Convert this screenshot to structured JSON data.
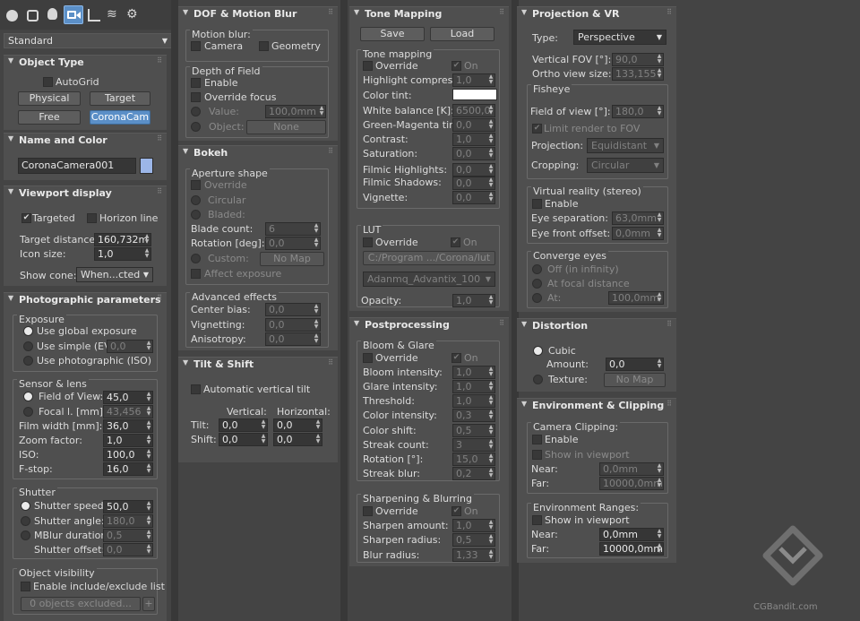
{
  "toolbar": {
    "icons": [
      "create-icon",
      "shapes-icon",
      "lights-icon",
      "cameras-icon",
      "helpers-icon",
      "spacewarps-icon",
      "systems-icon"
    ]
  },
  "category_dropdown": "Standard",
  "object_type": {
    "title": "Object Type",
    "autogrid": "AutoGrid",
    "buttons": [
      "Physical",
      "Target",
      "Free",
      "CoronaCam"
    ]
  },
  "name_color": {
    "title": "Name and Color",
    "name": "CoronaCamera001",
    "color": "#9cb6e8"
  },
  "viewport": {
    "title": "Viewport display",
    "targeted": "Targeted",
    "horizon": "Horizon line",
    "target_distance_label": "Target distance:",
    "target_distance": "160,732m",
    "icon_size_label": "Icon size:",
    "icon_size": "1,0",
    "show_cone_label": "Show cone:",
    "show_cone": "When...cted"
  },
  "photo": {
    "title": "Photographic parameters",
    "exposure": {
      "title": "Exposure",
      "global": "Use global exposure",
      "simple": "Use simple (EV)",
      "simple_val": "0,0",
      "iso": "Use photographic (ISO)"
    },
    "sensor": {
      "title": "Sensor & lens",
      "fov_label": "Field of View:",
      "fov": "45,0",
      "focal_label": "Focal l. [mm]:",
      "focal": "43,456",
      "film_label": "Film width [mm]:",
      "film": "36,0",
      "zoom_label": "Zoom factor:",
      "zoom": "1,0",
      "iso_label": "ISO:",
      "iso": "100,0",
      "fstop_label": "F-stop:",
      "fstop": "16,0"
    },
    "shutter": {
      "title": "Shutter",
      "speed_label": "Shutter speed:",
      "speed": "50,0",
      "angle_label": "Shutter angle:",
      "angle": "180,0",
      "mblur_label": "MBlur duration:",
      "mblur": "0,5",
      "offset_label": "Shutter offset:",
      "offset": "0,0"
    },
    "visibility": {
      "title": "Object visibility",
      "enable": "Enable include/exclude list",
      "excluded": "0 objects excluded...",
      "plus": "+"
    }
  },
  "dof": {
    "title": "DOF & Motion Blur",
    "motion_blur": "Motion blur:",
    "camera": "Camera",
    "geometry": "Geometry",
    "depth": "Depth of Field",
    "enable": "Enable",
    "override": "Override focus",
    "value_label": "Value:",
    "value": "100,0mm",
    "object_label": "Object:",
    "object": "None"
  },
  "bokeh": {
    "title": "Bokeh",
    "aperture": "Aperture shape",
    "override": "Override",
    "circular": "Circular",
    "bladed": "Bladed:",
    "blade_count_label": "Blade count:",
    "blade_count": "6",
    "rotation_label": "Rotation [deg]:",
    "rotation": "0,0",
    "custom_label": "Custom:",
    "custom": "No Map",
    "affect": "Affect exposure",
    "advanced": "Advanced effects",
    "center_bias_label": "Center bias:",
    "center_bias": "0,0",
    "vignetting_label": "Vignetting:",
    "vignetting": "0,0",
    "anisotropy_label": "Anisotropy:",
    "anisotropy": "0,0"
  },
  "tilt": {
    "title": "Tilt & Shift",
    "auto": "Automatic vertical tilt",
    "vertical": "Vertical:",
    "horizontal": "Horizontal:",
    "tilt_label": "Tilt:",
    "shift_label": "Shift:",
    "tilt_v": "0,0",
    "tilt_h": "0,0",
    "shift_v": "0,0",
    "shift_h": "0,0"
  },
  "tone": {
    "title": "Tone Mapping",
    "save": "Save",
    "load": "Load",
    "group": "Tone mapping",
    "override": "Override",
    "on": "On",
    "highlight_label": "Highlight compress:",
    "highlight": "1,0",
    "tint_label": "Color tint:",
    "tint_color": "#ffffff",
    "wb_label": "White balance [K]:",
    "wb": "6500,0",
    "gm_label": "Green-Magenta tint:",
    "gm": "0,0",
    "contrast_label": "Contrast:",
    "contrast": "1,0",
    "saturation_label": "Saturation:",
    "saturation": "0,0",
    "fh_label": "Filmic Highlights:",
    "fh": "0,0",
    "fs_label": "Filmic Shadows:",
    "fs": "0,0",
    "vignette_label": "Vignette:",
    "vignette": "0,0",
    "lut": "LUT",
    "lut_override": "Override",
    "lut_on": "On",
    "lut_path": "C:/Program .../Corona/lut",
    "lut_name": "Adanmq_Advantix_100",
    "opacity_label": "Opacity:",
    "opacity": "1,0"
  },
  "post": {
    "title": "Postprocessing",
    "bloom": "Bloom & Glare",
    "override": "Override",
    "on": "On",
    "bi_label": "Bloom intensity:",
    "bi": "1,0",
    "gi_label": "Glare intensity:",
    "gi": "1,0",
    "th_label": "Threshold:",
    "th": "1,0",
    "ci_label": "Color intensity:",
    "ci": "0,3",
    "cs_label": "Color shift:",
    "cs": "0,5",
    "sc_label": "Streak count:",
    "sc": "3",
    "rot_label": "Rotation [°]:",
    "rot": "15,0",
    "sb_label": "Streak blur:",
    "sb": "0,2",
    "sharp": "Sharpening & Blurring",
    "s_override": "Override",
    "s_on": "On",
    "sa_label": "Sharpen amount:",
    "sa": "1,0",
    "sr_label": "Sharpen radius:",
    "sr": "0,5",
    "br_label": "Blur radius:",
    "br": "1,33"
  },
  "proj": {
    "title": "Projection & VR",
    "type_label": "Type:",
    "type": "Perspective",
    "vfov_label": "Vertical FOV [°]:",
    "vfov": "90,0",
    "ortho_label": "Ortho view size:",
    "ortho": "133,155",
    "fisheye": "Fisheye",
    "ffov_label": "Field of view [°]:",
    "ffov": "180,0",
    "limit": "Limit render to FOV",
    "projection_label": "Projection:",
    "projection": "Equidistant",
    "cropping_label": "Cropping:",
    "cropping": "Circular",
    "vr": "Virtual reality (stereo)",
    "vr_enable": "Enable",
    "eye_sep_label": "Eye separation:",
    "eye_sep": "63,0mm",
    "eye_front_label": "Eye front offset:",
    "eye_front": "0,0mm",
    "converge": "Converge eyes",
    "c_off": "Off (in infinity)",
    "c_focal": "At focal distance",
    "c_at": "At:",
    "c_at_val": "100,0mm"
  },
  "distortion": {
    "title": "Distortion",
    "cubic": "Cubic",
    "amount_label": "Amount:",
    "amount": "0,0",
    "texture_label": "Texture:",
    "texture": "No Map"
  },
  "env": {
    "title": "Environment & Clipping",
    "clipping": "Camera Clipping:",
    "enable": "Enable",
    "show": "Show in viewport",
    "near_label": "Near:",
    "near": "0,0mm",
    "far_label": "Far:",
    "far": "10000,0mm",
    "ranges": "Environment Ranges:",
    "r_show": "Show in viewport",
    "r_near_label": "Near:",
    "r_near": "0,0mm",
    "r_far_label": "Far:",
    "r_far": "10000,0mm"
  },
  "watermark": "CGBandit.com"
}
